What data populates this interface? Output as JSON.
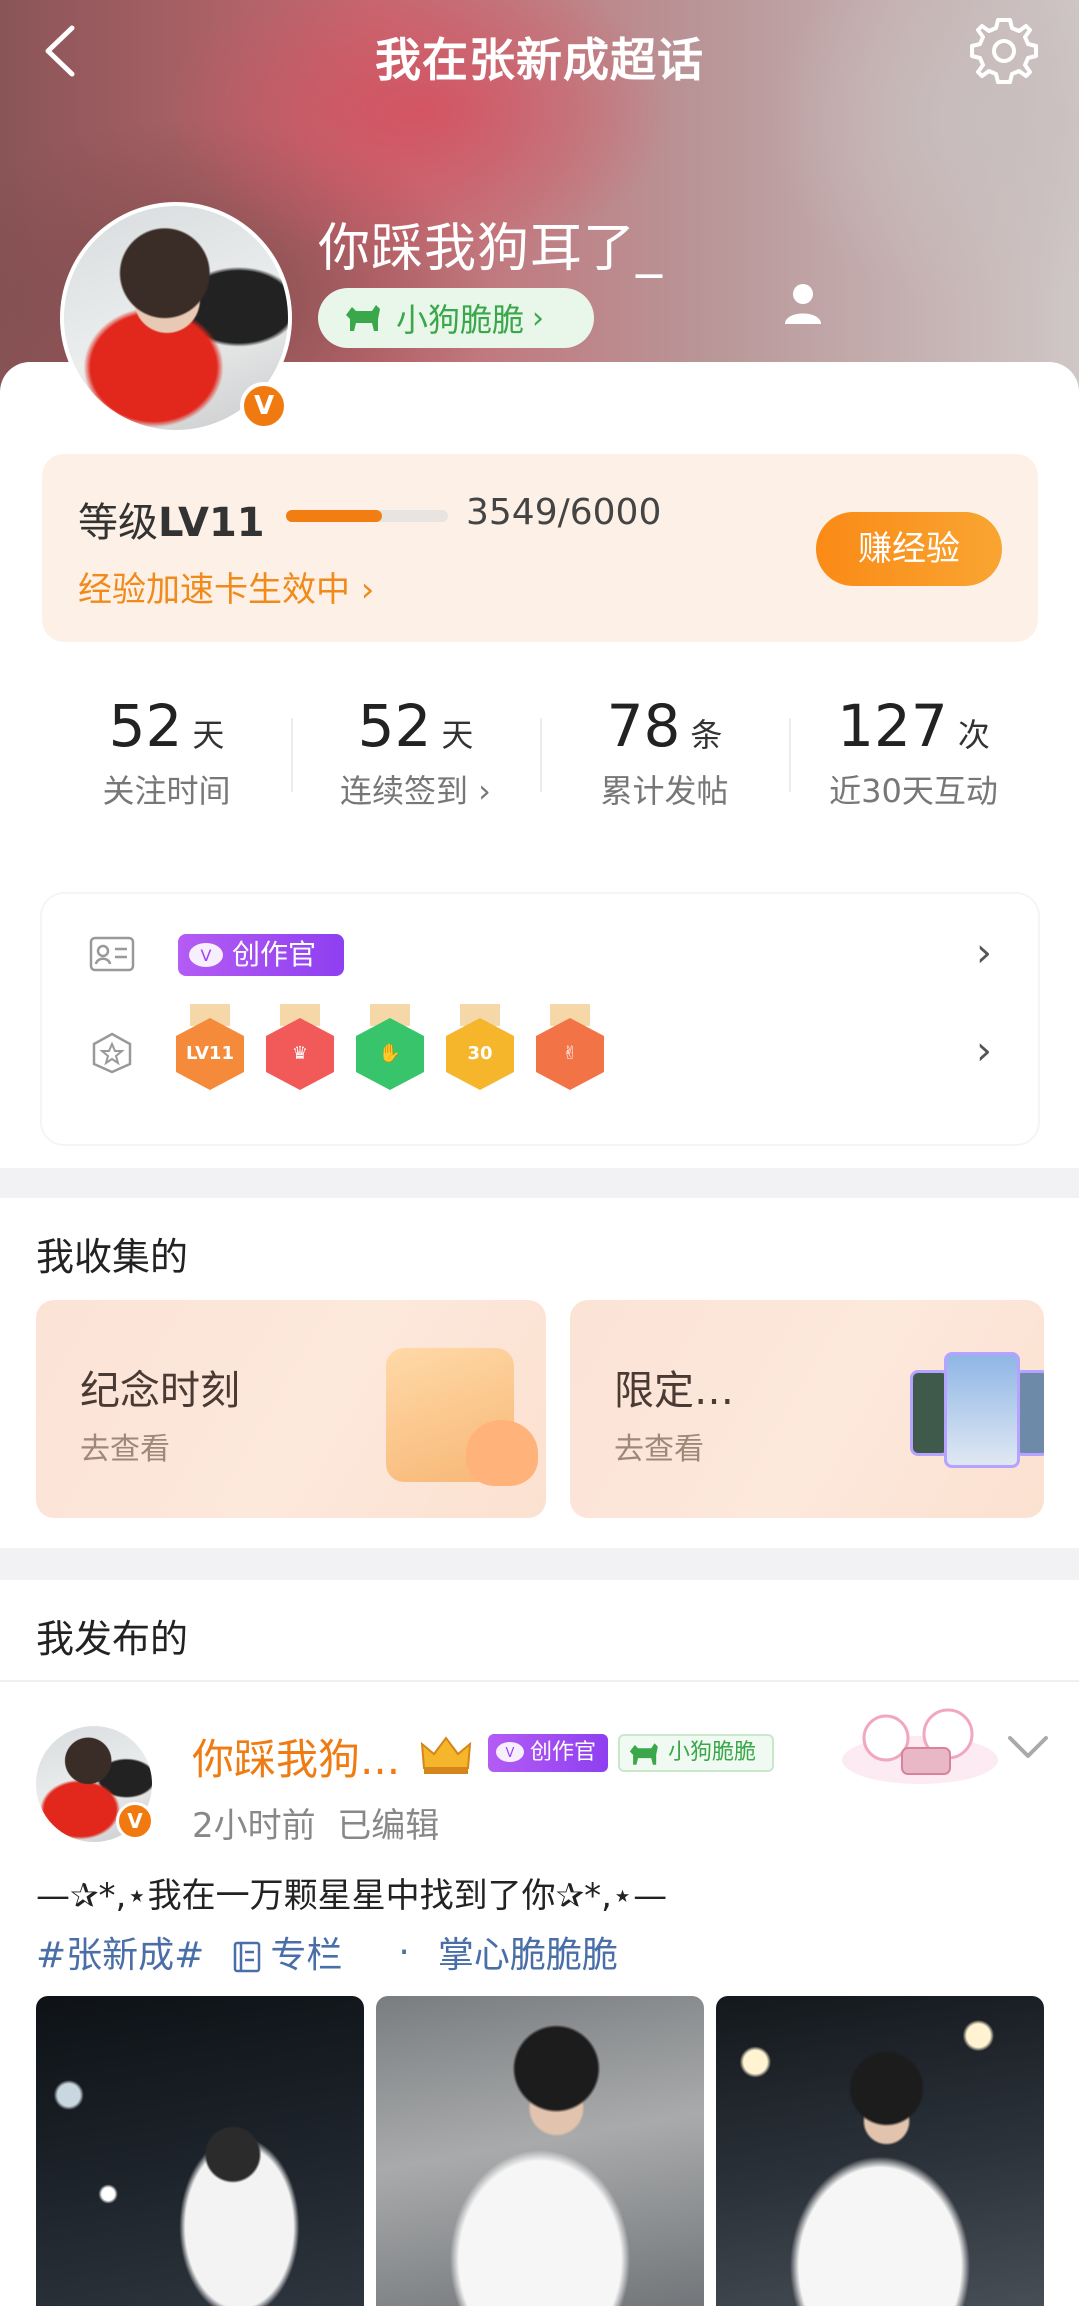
{
  "header": {
    "title": "我在张新成超话",
    "back_icon": "chevron-left-icon",
    "settings_icon": "gear-icon"
  },
  "profile": {
    "username": "你踩我狗耳了_",
    "fan_tag": "小狗脆脆",
    "verified_mark": "V"
  },
  "level": {
    "label_prefix": "等级",
    "level_text": "LV11",
    "progress_text": "3549/6000",
    "progress_fraction": 0.5915,
    "boost_text": "经验加速卡生效中 ›",
    "earn_button": "赚经验"
  },
  "stats": [
    {
      "value": "52",
      "unit": "天",
      "label": "关注时间"
    },
    {
      "value": "52",
      "unit": "天",
      "label": "连续签到 ›"
    },
    {
      "value": "78",
      "unit": "条",
      "label": "累计发帖"
    },
    {
      "value": "127",
      "unit": "次",
      "label": "近30天互动"
    }
  ],
  "badges": {
    "creator_tag": "创作官",
    "medals": [
      {
        "text": "LV11",
        "color": "#f58a3a"
      },
      {
        "text": "",
        "color": "#f25a5a"
      },
      {
        "text": "",
        "color": "#38c46a"
      },
      {
        "text": "30",
        "color": "#f5b62b"
      },
      {
        "text": "",
        "color": "#f27346"
      }
    ]
  },
  "collected": {
    "title": "我收集的",
    "cards": [
      {
        "title": "纪念时刻",
        "sub": "去查看"
      },
      {
        "title": "限定…",
        "sub": "去查看"
      }
    ]
  },
  "posted": {
    "title": "我发布的",
    "post": {
      "name": "你踩我狗...",
      "creator_tag": "创作官",
      "fan_tag": "小狗脆脆",
      "time": "2小时前",
      "edited": "已编辑",
      "text": "—✰*,⋆我在一万颗星星中找到了你✰*,⋆—",
      "tag": "#张新成#",
      "column": "专栏",
      "dot": "·",
      "column_name": "掌心脆脆脆"
    }
  },
  "colors": {
    "accent_orange": "#f27d12",
    "verify_orange": "#f07a10",
    "fan_green": "#3aa74a",
    "creator_purple": "#9b46f2",
    "link_blue": "#4a6ea8"
  }
}
